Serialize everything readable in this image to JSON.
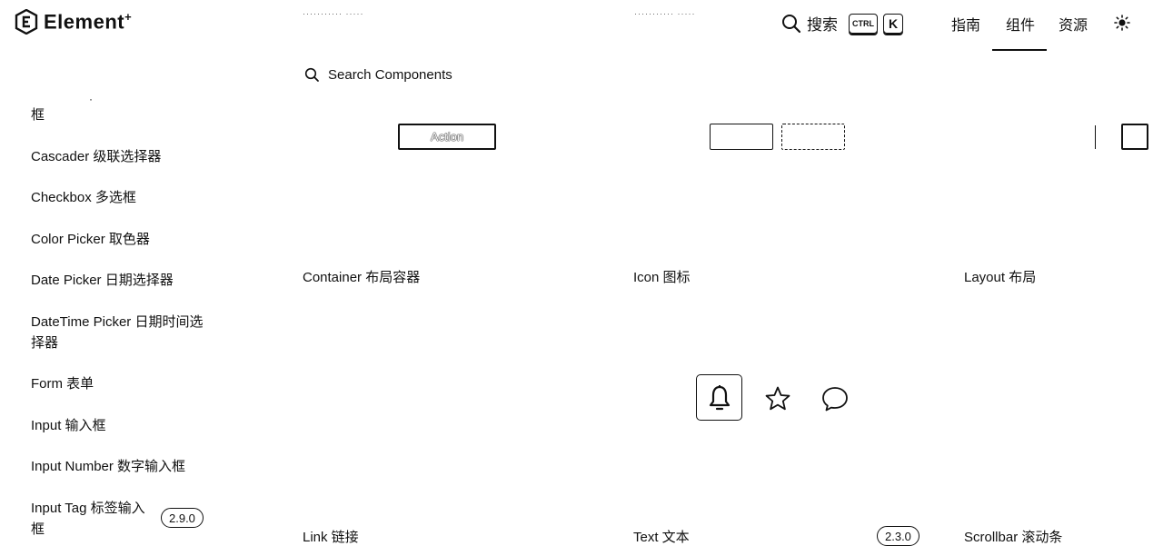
{
  "header": {
    "logo_text": "Element",
    "logo_plus": "+",
    "dots_left": "··········· ·····",
    "dots_right": "··········· ·····",
    "search_label": "搜索",
    "kbd_ctrl": "CTRL",
    "kbd_k": "K",
    "nav": [
      "指南",
      "组件",
      "资源"
    ],
    "active_nav": "组件"
  },
  "search": {
    "placeholder": "Search Components"
  },
  "sidebar": {
    "items": [
      "·",
      "框",
      "Cascader 级联选择器",
      "Checkbox 多选框",
      "Color Picker 取色器",
      "Date Picker 日期选择器",
      "DateTime Picker 日期时间选",
      "择器",
      "Form 表单",
      "Input 输入框",
      "Input Number 数字输入框",
      "Input Tag 标签输入",
      "框"
    ],
    "version_badge": "2.9.0"
  },
  "cards": {
    "row1": [
      "Container 布局容器",
      "Icon 图标",
      "Layout 布局"
    ],
    "row2": [
      "Link 链接",
      "Text 文本",
      "Scrollbar 滚动条"
    ],
    "text_badge": "2.3.0",
    "action_label": "Action"
  },
  "icons": [
    "bell-icon",
    "star-icon",
    "chat-bubble-icon",
    "search-icon",
    "sun-icon"
  ]
}
